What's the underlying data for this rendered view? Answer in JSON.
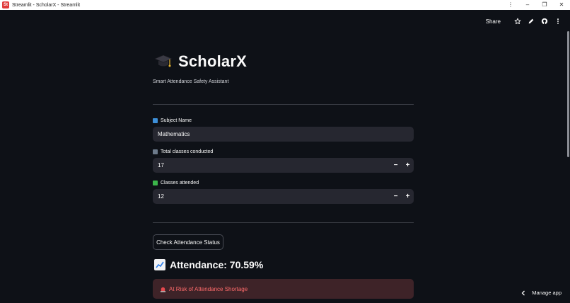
{
  "window": {
    "title": "Streamlit - ScholarX - Streamlit",
    "app_icon_text": "St",
    "controls": {
      "menu": "⋮",
      "minimize": "–",
      "restore": "❐",
      "close": "✕"
    }
  },
  "toolbar": {
    "share_label": "Share",
    "icons": [
      "star-icon",
      "pencil-icon",
      "github-icon",
      "more-vert-icon"
    ]
  },
  "header": {
    "title": "ScholarX",
    "subtitle": "Smart Attendance Safety Assistant"
  },
  "form": {
    "subject": {
      "label": "Subject Name",
      "value": "Mathematics",
      "icon": "blue-book-icon"
    },
    "total_classes": {
      "label": "Total classes conducted",
      "value": "17",
      "icon": "bar-chart-icon",
      "minus": "−",
      "plus": "+"
    },
    "attended": {
      "label": "Classes attended",
      "value": "12",
      "icon": "check-mark-icon",
      "minus": "−",
      "plus": "+"
    }
  },
  "actions": {
    "check_button": "Check Attendance Status"
  },
  "result": {
    "attendance_text": "Attendance: 70.59%",
    "alert_text": "At Risk of Attendance Shortage",
    "alert_icon": "siren-icon"
  },
  "footer": {
    "manage_app": "Manage app"
  },
  "colors": {
    "background": "#0e1117",
    "input_bg": "#262730",
    "alert_bg": "#3e2328",
    "alert_text": "#ff6b6b",
    "accent_red": "#e03b3b"
  }
}
